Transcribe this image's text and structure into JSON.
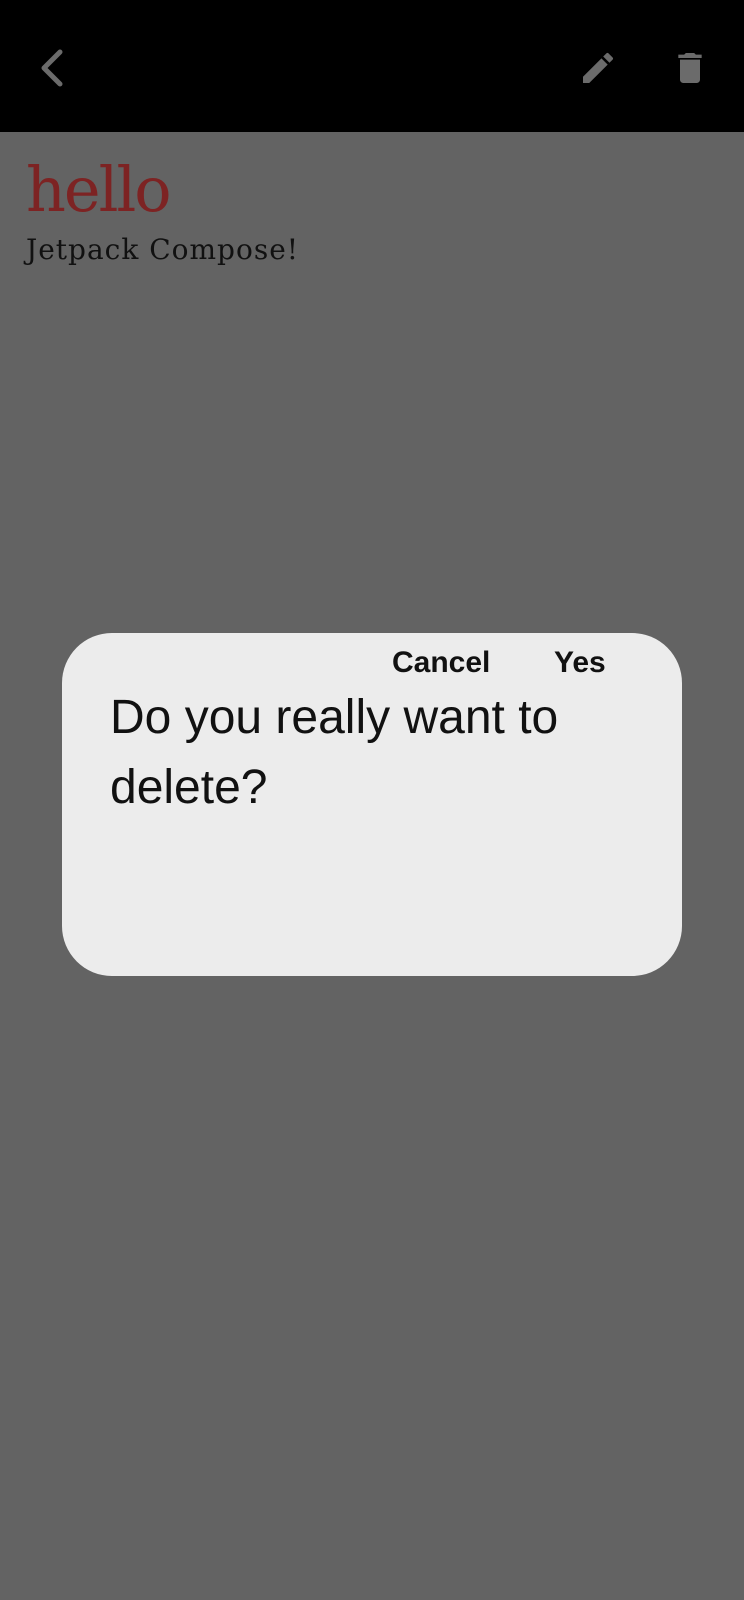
{
  "toolbar": {
    "back_icon": "chevron-left-icon",
    "edit_icon": "pencil-icon",
    "delete_icon": "trash-icon",
    "background_color": "#000000",
    "icon_color": "#6b6b6b"
  },
  "note": {
    "title": "hello",
    "body": "Jetpack Compose!",
    "title_color": "#7d2323"
  },
  "dialog": {
    "message": "Do you really want to delete?",
    "cancel_label": "Cancel",
    "confirm_label": "Yes",
    "background_color": "#ececec"
  },
  "scrim_color": "#636363"
}
